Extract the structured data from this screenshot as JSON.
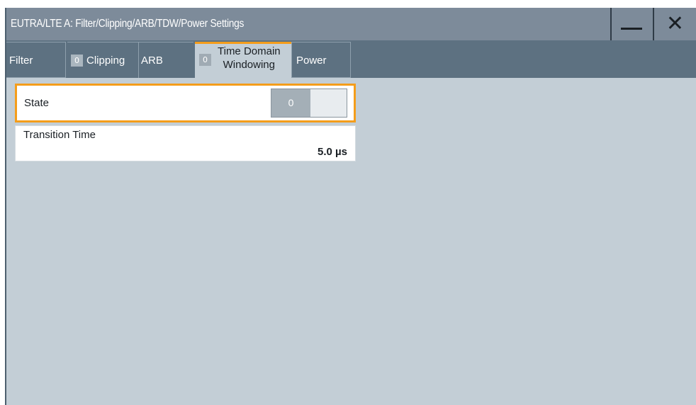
{
  "window": {
    "title": "EUTRA/LTE A: Filter/Clipping/ARB/TDW/Power Settings"
  },
  "titlebar": {
    "minimize_icon": "minimize-icon",
    "close_icon": "close-icon",
    "close_glyph": "✕"
  },
  "tabs": [
    {
      "label": "Filter"
    },
    {
      "label": "Clipping",
      "badge": "0"
    },
    {
      "label": "ARB"
    },
    {
      "label_line1": "Time Domain",
      "label_line2": "Windowing",
      "badge": "0",
      "active": true
    },
    {
      "label": "Power"
    }
  ],
  "tdw": {
    "state": {
      "label": "State",
      "value": "0"
    },
    "transition_time": {
      "label": "Transition Time",
      "value": "5.0  µs"
    }
  },
  "colors": {
    "accent": "#f49d1b",
    "titlebar": "#7d8b9a",
    "tabbar": "#5d7181",
    "panel": "#c3ced6"
  }
}
